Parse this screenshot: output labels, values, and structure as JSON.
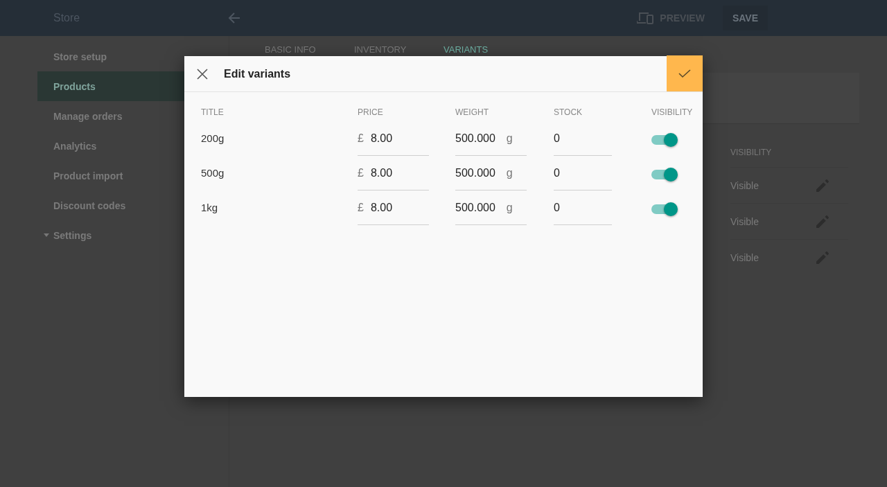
{
  "app_bar": {
    "title": "Store",
    "preview_label": "PREVIEW",
    "save_label": "SAVE"
  },
  "sidebar": {
    "items": [
      {
        "label": "Store setup",
        "selected": false,
        "kind": "link"
      },
      {
        "label": "Products",
        "selected": true,
        "kind": "link"
      },
      {
        "label": "Manage orders",
        "selected": false,
        "kind": "link"
      },
      {
        "label": "Analytics",
        "selected": false,
        "kind": "link"
      },
      {
        "label": "Product import",
        "selected": false,
        "kind": "link"
      },
      {
        "label": "Discount codes",
        "selected": false,
        "kind": "link"
      },
      {
        "label": "Settings",
        "selected": false,
        "kind": "group"
      }
    ]
  },
  "tabs": [
    {
      "label": "BASIC INFO",
      "selected": false
    },
    {
      "label": "INVENTORY",
      "selected": false
    },
    {
      "label": "VARIANTS",
      "selected": true
    }
  ],
  "background_table": {
    "column": "VISIBILITY",
    "rows": [
      "Visible",
      "Visible",
      "Visible"
    ]
  },
  "dialog": {
    "title": "Edit variants",
    "columns": [
      "TITLE",
      "PRICE",
      "WEIGHT",
      "STOCK",
      "VISIBILITY"
    ],
    "rows": [
      {
        "title": "200g",
        "currency": "£",
        "price": "8.00",
        "weight": "500.000",
        "unit": "g",
        "stock": "0",
        "visible": true
      },
      {
        "title": "500g",
        "currency": "£",
        "price": "8.00",
        "weight": "500.000",
        "unit": "g",
        "stock": "0",
        "visible": true
      },
      {
        "title": "1kg",
        "currency": "£",
        "price": "8.00",
        "weight": "500.000",
        "unit": "g",
        "stock": "0",
        "visible": true
      }
    ]
  }
}
